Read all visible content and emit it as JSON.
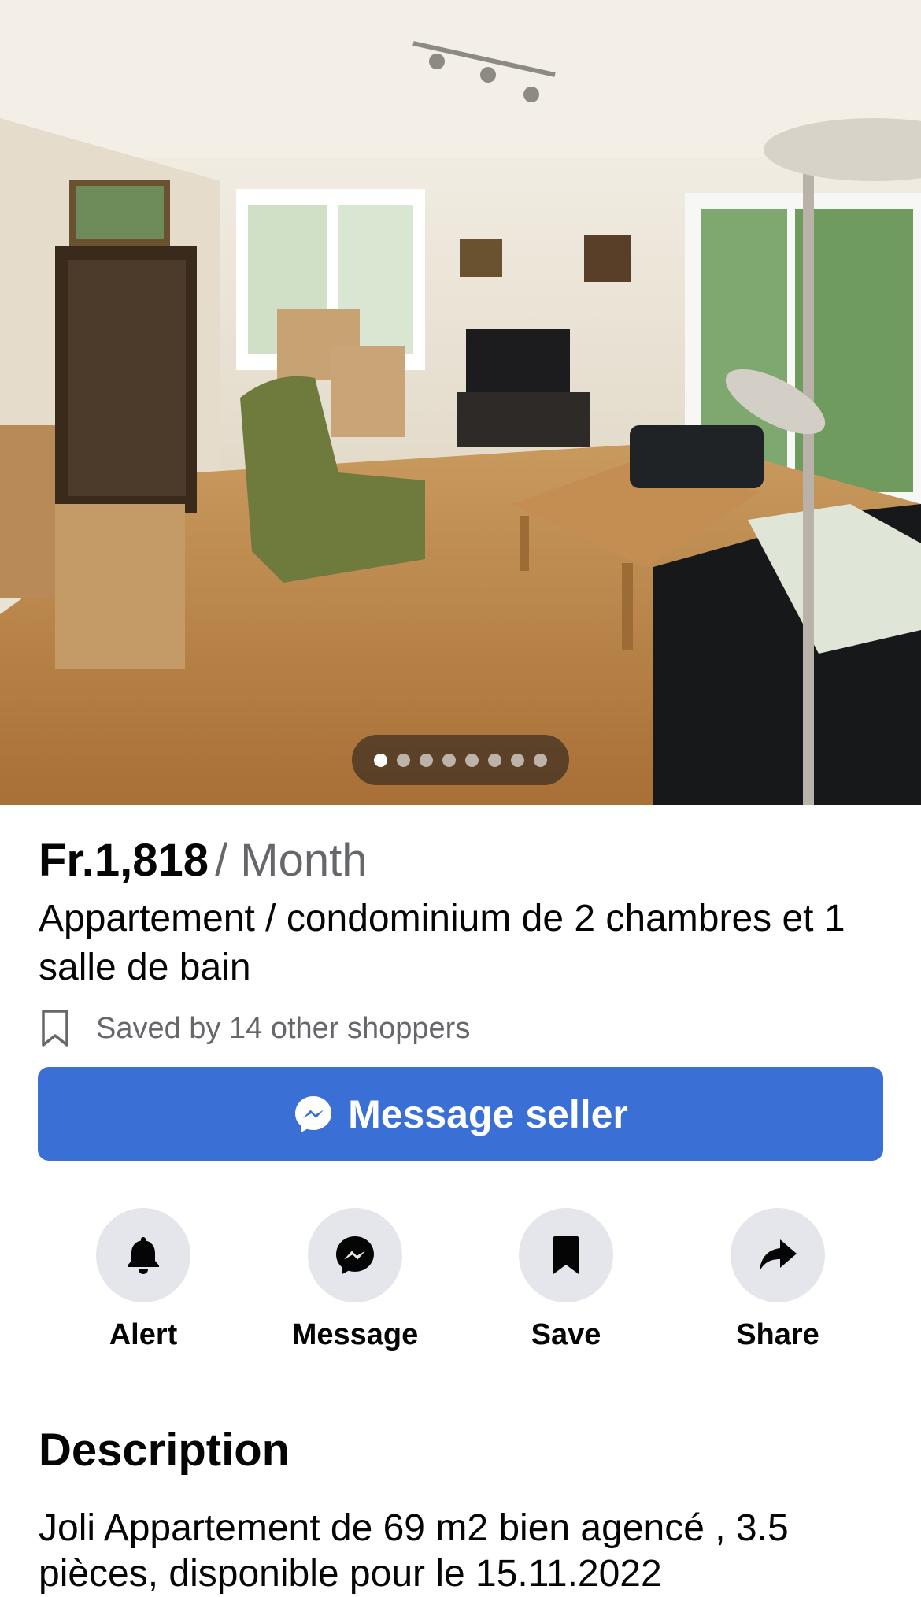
{
  "gallery": {
    "photo_count": 8,
    "active_index": 0
  },
  "listing": {
    "price": "Fr.1,818",
    "period": "/ Month",
    "title": "Appartement / condominium de 2 chambres et 1 salle de bain",
    "saved_text": "Saved by 14 other shoppers"
  },
  "primary_action": {
    "label": "Message seller",
    "color": "#3a6fd6"
  },
  "actions": [
    {
      "label": "Alert",
      "icon": "bell-icon"
    },
    {
      "label": "Message",
      "icon": "messenger-icon"
    },
    {
      "label": "Save",
      "icon": "bookmark-icon"
    },
    {
      "label": "Share",
      "icon": "share-arrow-icon"
    }
  ],
  "description": {
    "heading": "Description",
    "body": "Joli Appartement de 69 m2 bien agencé , 3.5 pièces, disponible pour le 15.11.2022"
  }
}
